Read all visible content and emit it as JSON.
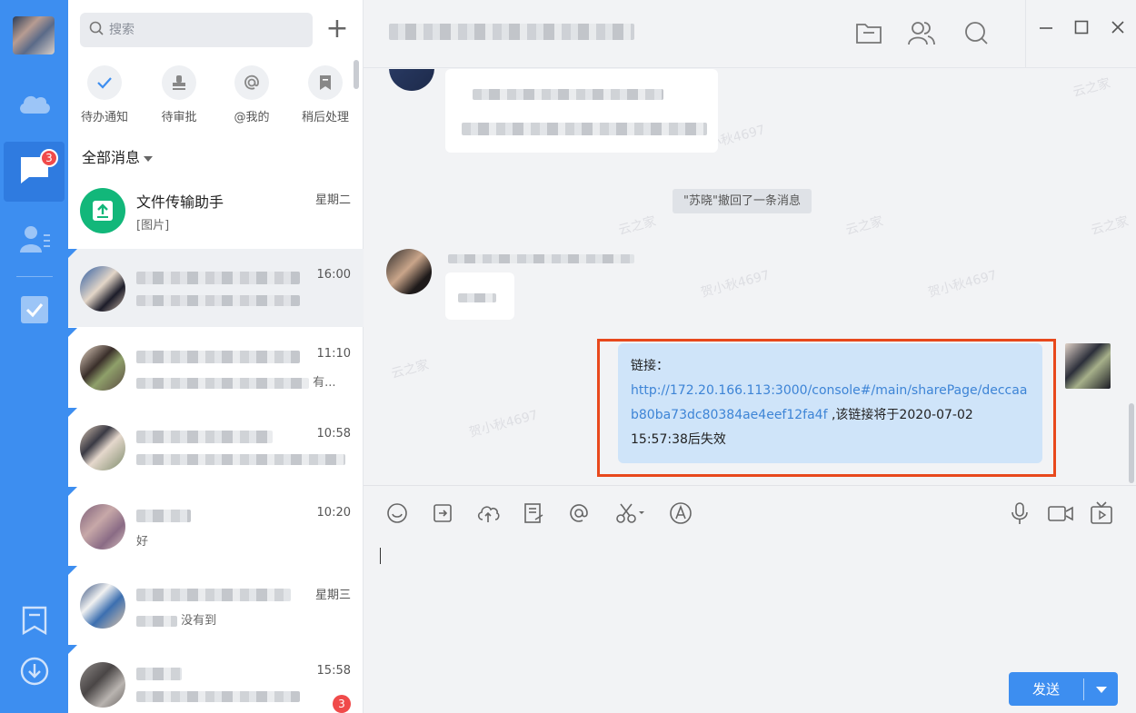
{
  "rail": {
    "chat_badge": "3"
  },
  "list": {
    "search_placeholder": "搜索",
    "plus_label": "+",
    "quick_actions": [
      {
        "label": "待办通知"
      },
      {
        "label": "待审批"
      },
      {
        "label": "@我的"
      },
      {
        "label": "稍后处理"
      }
    ],
    "filter_label": "全部消息",
    "conversations": [
      {
        "name": "文件传输助手",
        "preview": "[图片]",
        "time": "星期二"
      },
      {
        "name": "",
        "preview": "",
        "time": "16:00"
      },
      {
        "name": "",
        "preview": "有...",
        "time": "11:10"
      },
      {
        "name": "",
        "preview": "",
        "time": "10:58"
      },
      {
        "name": "",
        "preview": "好",
        "time": "10:20"
      },
      {
        "name": "",
        "preview": "没有到",
        "time": "星期三"
      },
      {
        "name": "",
        "preview": "",
        "time": "15:58",
        "badge": "3"
      }
    ]
  },
  "chat": {
    "recall_notice": "\"苏晓\"撤回了一条消息",
    "watermarks": [
      "云之家",
      "贺小秋4697"
    ],
    "my_message": {
      "prefix": "链接：",
      "url": "http://172.20.166.113:3000/console#/main/sharePage/deccaab80ba73dc80384ae4eef12fa4f",
      "suffix": " ,该链接将于2020-07-02 15:57:38后失效"
    },
    "send_label": "发送"
  },
  "colors": {
    "rail_blue": "#3d8ef0",
    "my_bubble": "#cfe4f9",
    "highlight_border": "#e8481c",
    "badge_red": "#f04a4a",
    "link": "#3d84d6"
  }
}
